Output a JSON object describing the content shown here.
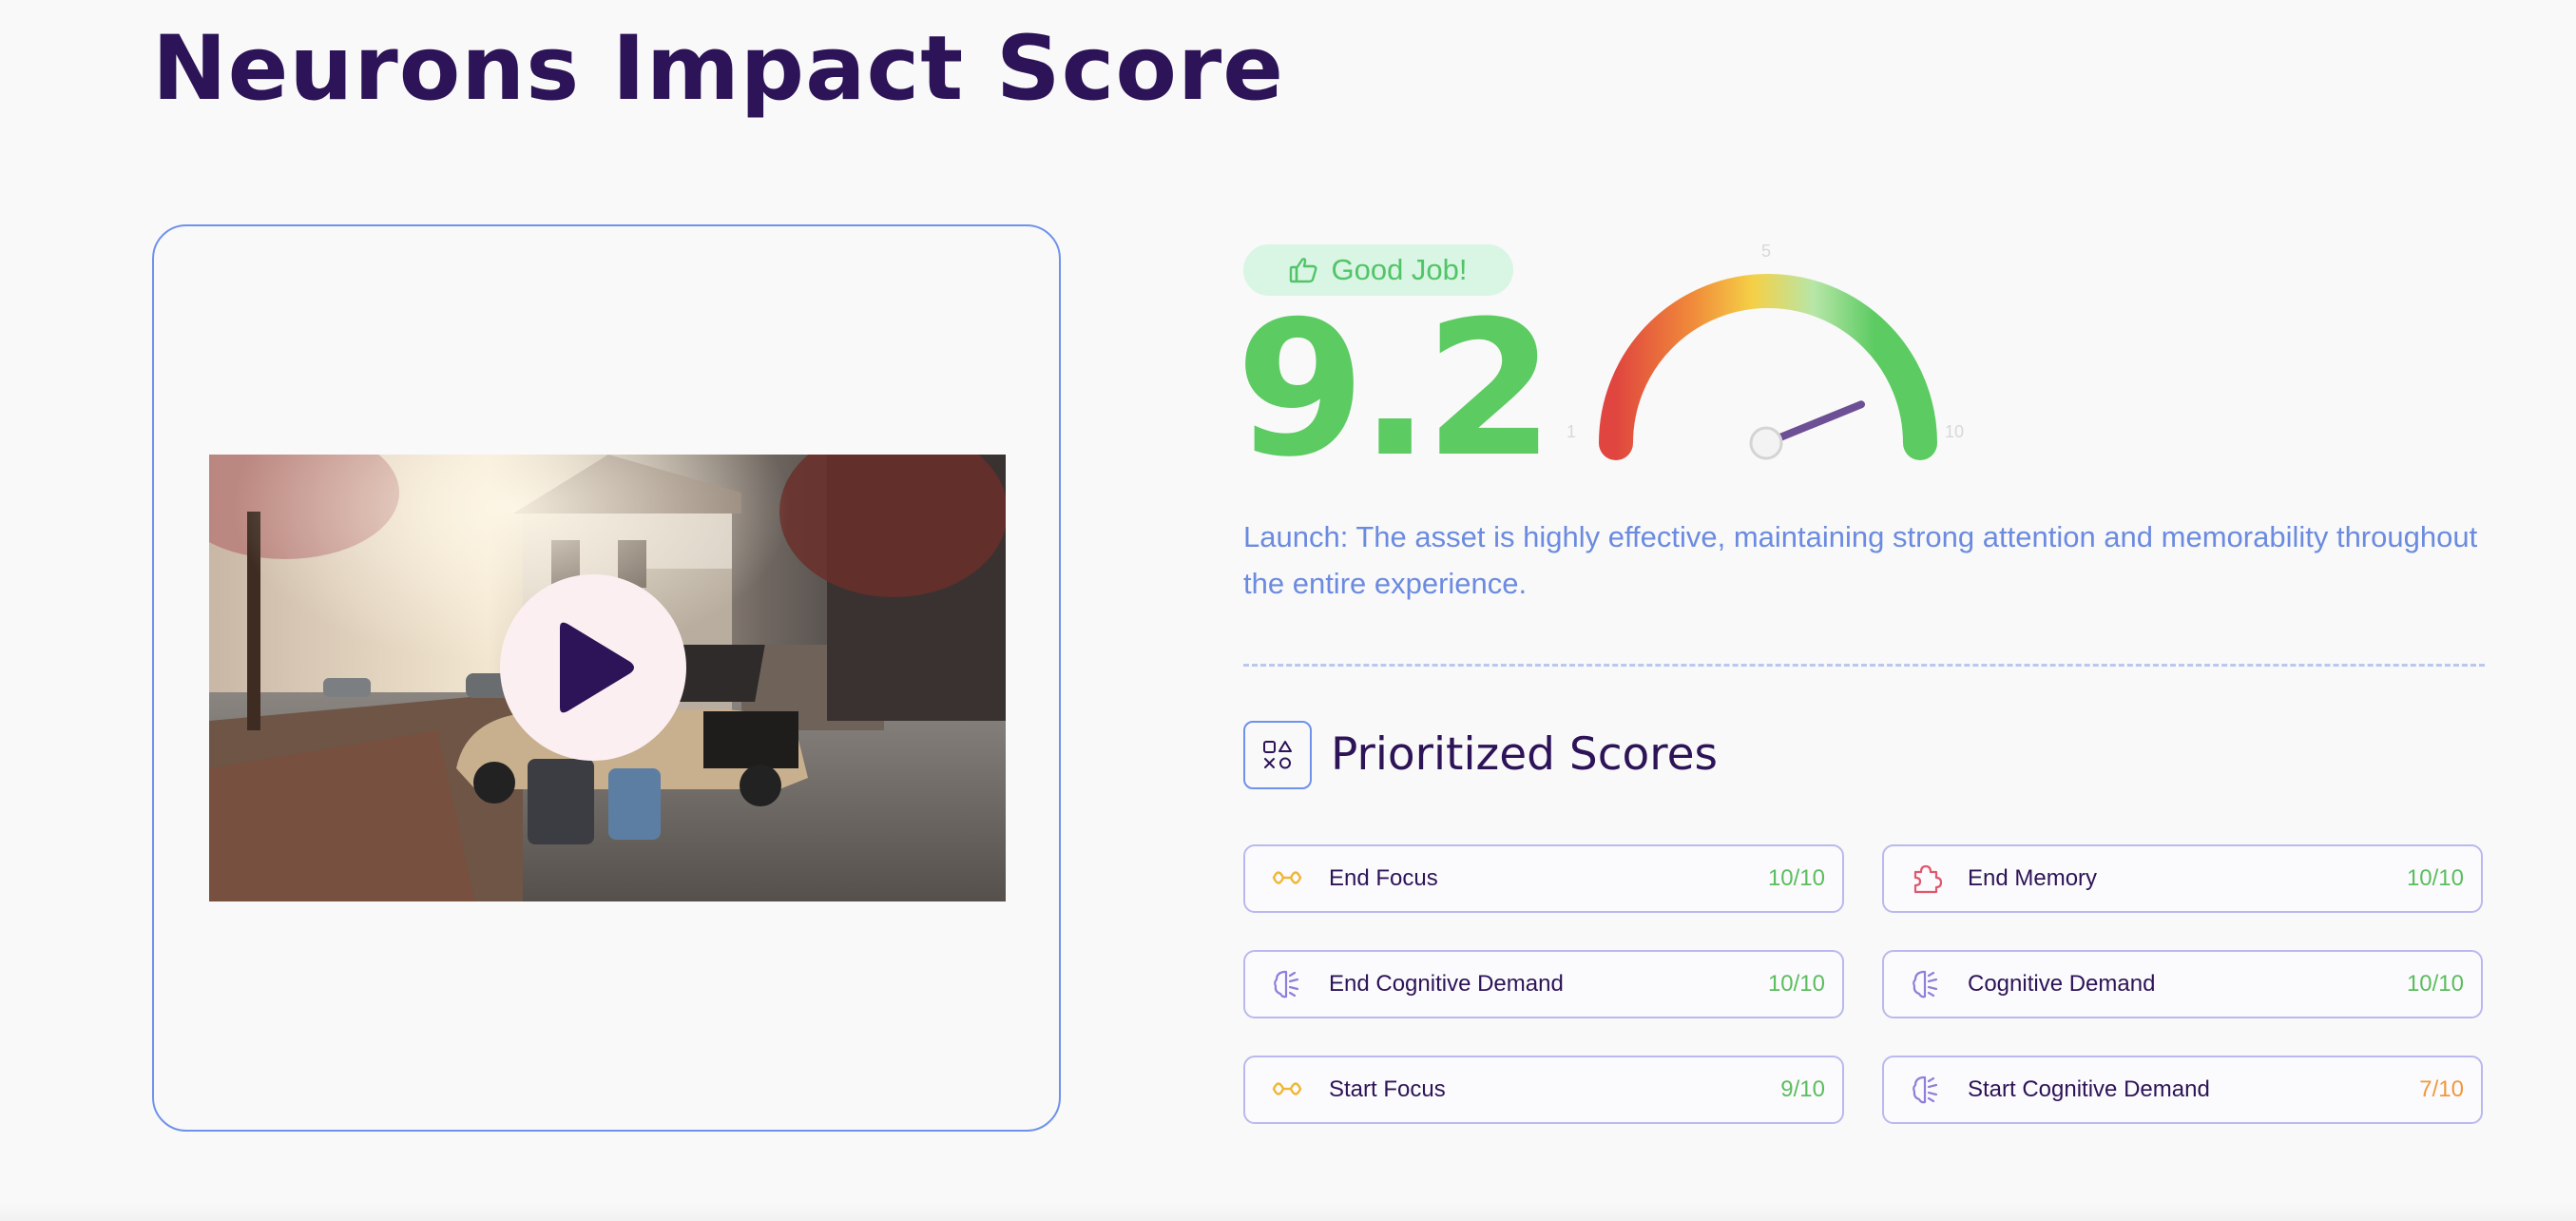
{
  "page": {
    "title": "Neurons Impact Score"
  },
  "media": {
    "thumbnail": "video-thumbnail-street-car-luggage",
    "play_icon": "play-icon"
  },
  "score": {
    "badge_icon": "thumbs-up-icon",
    "badge_label": "Good Job!",
    "value": "9.2",
    "gauge": {
      "min_label": "1",
      "mid_label": "5",
      "max_label": "10",
      "value": 9.2
    },
    "description": "Launch: The asset is highly effective, maintaining strong attention and memorability throughout the entire experience."
  },
  "prioritized": {
    "title": "Prioritized Scores",
    "icon": "shapes-icon",
    "items": [
      {
        "label": "End Focus",
        "value": "10/10",
        "icon": "focus-icon",
        "color": "#5bbd5e"
      },
      {
        "label": "End Memory",
        "value": "10/10",
        "icon": "puzzle-icon",
        "color": "#5bbd5e"
      },
      {
        "label": "End Cognitive Demand",
        "value": "10/10",
        "icon": "brain-icon",
        "color": "#5bbd5e"
      },
      {
        "label": "Cognitive Demand",
        "value": "10/10",
        "icon": "brain-icon",
        "color": "#5bbd5e"
      },
      {
        "label": "Start Focus",
        "value": "9/10",
        "icon": "focus-icon",
        "color": "#5bbd5e"
      },
      {
        "label": "Start Cognitive Demand",
        "value": "7/10",
        "icon": "brain-icon",
        "color": "#f0983a"
      }
    ]
  },
  "colors": {
    "title": "#2d1357",
    "score_green": "#5ccb62",
    "accent_blue": "#6f92ea",
    "warning_orange": "#f0983a"
  }
}
